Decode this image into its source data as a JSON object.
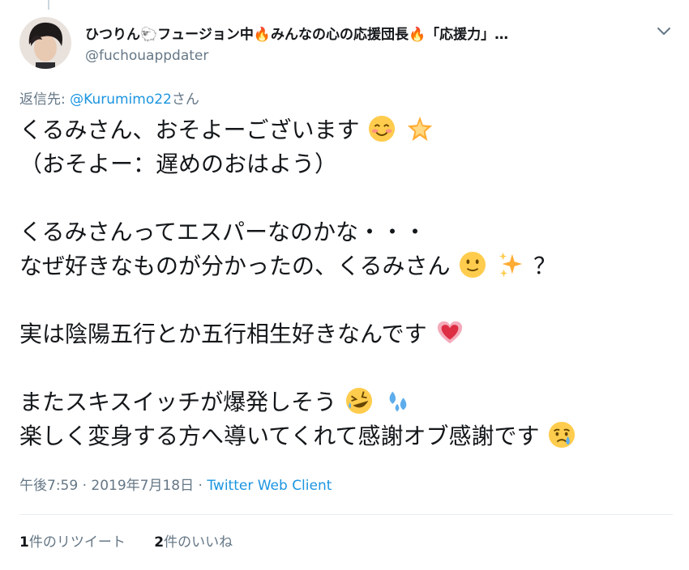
{
  "tweet": {
    "author": {
      "display_name": "ひつりん🐑フュージョン中🔥みんなの心の応援団長🔥「応援力」…",
      "handle": "@fuchouappdater"
    },
    "reply_to": {
      "prefix": "返信先: ",
      "mention": "@Kurumimo22",
      "suffix": "さん"
    },
    "lines": {
      "l1_text": "くるみさん、おそよーございます",
      "l2_text": "（おそよー：遅めのおはよう）",
      "l3_text": "くるみさんってエスパーなのかな・・・",
      "l4_text": "なぜ好きなものが分かったの、くるみさん",
      "l4_tail": "？",
      "l5_text": "実は陰陽五行とか五行相生好きなんです",
      "l6_text": "またスキスイッチが爆発しそう",
      "l7_text": "楽しく変身する方へ導いてくれて感謝オブ感謝です"
    },
    "emojis": {
      "l1": [
        "smiling-face-icon",
        "glowing-star-icon"
      ],
      "l4": [
        "slightly-smiling-face-icon",
        "sparkles-icon"
      ],
      "l5": [
        "heart-icon"
      ],
      "l6": [
        "rolling-laughing-face-icon",
        "sweat-droplets-icon"
      ],
      "l7": [
        "crying-face-icon"
      ]
    },
    "meta": {
      "time": "午後7:59",
      "sep1": " · ",
      "date": "2019年7月18日",
      "sep2": " · ",
      "source": "Twitter Web Client"
    },
    "stats": {
      "retweet_count": "1",
      "retweet_label": "件のリツイート",
      "like_count": "2",
      "like_label": "件のいいね"
    }
  },
  "colors": {
    "link": "#1b95e0",
    "secondary_text": "#657786",
    "primary_text": "#14171a",
    "divider": "#e6ecf0"
  }
}
